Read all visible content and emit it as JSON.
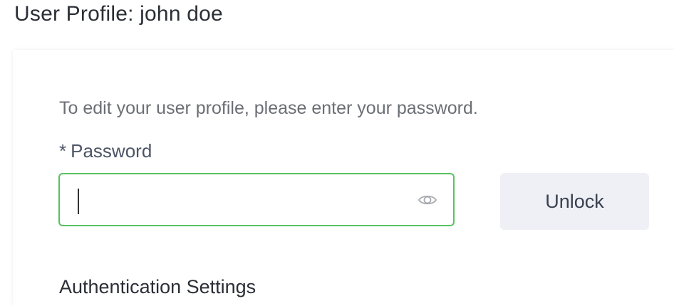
{
  "header": {
    "title": "User Profile: john doe"
  },
  "unlock_form": {
    "instructions": "To edit your user profile, please enter your password.",
    "required_mark": "*",
    "password_label": "Password",
    "password_value": "",
    "password_icon": "eye-icon",
    "unlock_label": "Unlock"
  },
  "next_section": {
    "heading": "Authentication Settings"
  },
  "colors": {
    "input_focus_border": "#58c35e",
    "button_bg": "#eef0f5"
  }
}
